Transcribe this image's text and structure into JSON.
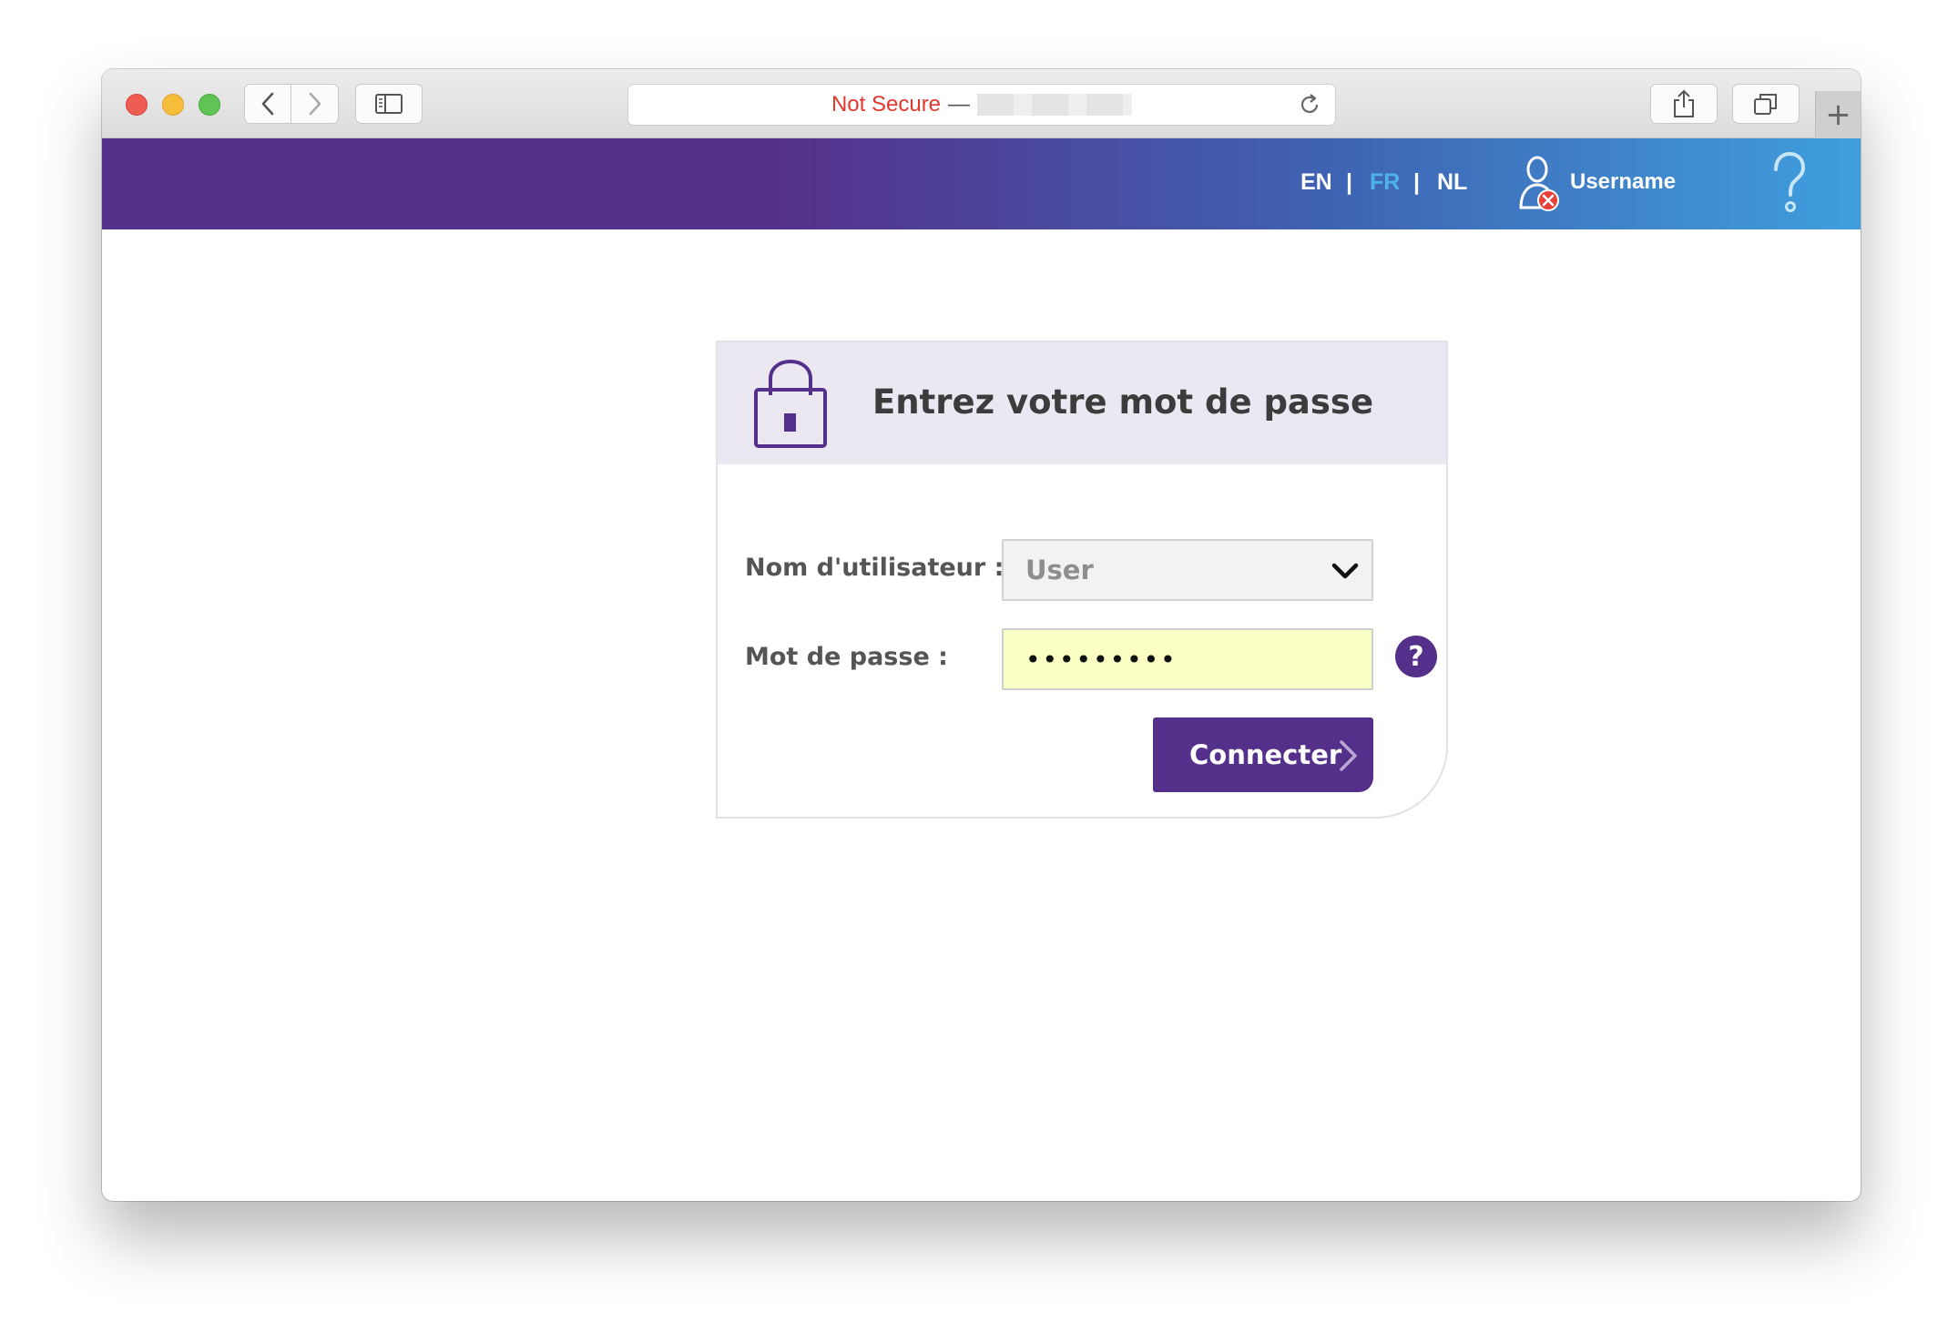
{
  "browser": {
    "address_status": "Not Secure",
    "address_separator": "—",
    "new_tab_symbol": "+"
  },
  "header": {
    "languages": [
      {
        "code": "EN",
        "active": false
      },
      {
        "code": "FR",
        "active": true
      },
      {
        "code": "NL",
        "active": false
      }
    ],
    "separator": "|",
    "username": "Username",
    "colors": {
      "purple": "#55308a",
      "blue": "#3f9fde",
      "active_lang": "#4fb3ea"
    }
  },
  "login": {
    "title": "Entrez votre mot de passe",
    "username_label": "Nom d'utilisateur :",
    "username_value": "User",
    "password_label": "Mot de passe :",
    "password_value": "•••••••••",
    "help_symbol": "?",
    "submit_label": "Connecter",
    "colors": {
      "header_bg": "#ebe8f2",
      "password_bg": "#fbffc4",
      "button": "#55308a"
    }
  }
}
